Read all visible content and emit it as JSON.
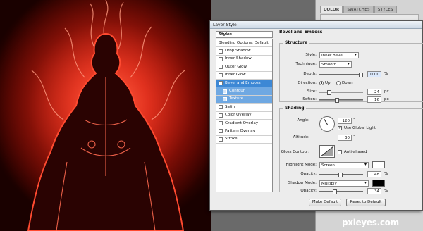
{
  "dialog": {
    "title": "Layer Style",
    "styles_header": "Styles",
    "style_items": [
      {
        "label": "Blending Options: Default",
        "checkbox": false,
        "state": "normal"
      },
      {
        "label": "Drop Shadow",
        "checkbox": true,
        "checked": false,
        "state": "normal"
      },
      {
        "label": "Inner Shadow",
        "checkbox": true,
        "checked": false,
        "state": "normal"
      },
      {
        "label": "Outer Glow",
        "checkbox": true,
        "checked": false,
        "state": "normal"
      },
      {
        "label": "Inner Glow",
        "checkbox": true,
        "checked": false,
        "state": "normal"
      },
      {
        "label": "Bevel and Emboss",
        "checkbox": true,
        "checked": true,
        "state": "selected"
      },
      {
        "label": "Contour",
        "checkbox": true,
        "checked": false,
        "state": "sub"
      },
      {
        "label": "Texture",
        "checkbox": true,
        "checked": false,
        "state": "sub"
      },
      {
        "label": "Satin",
        "checkbox": true,
        "checked": false,
        "state": "normal"
      },
      {
        "label": "Color Overlay",
        "checkbox": true,
        "checked": false,
        "state": "normal"
      },
      {
        "label": "Gradient Overlay",
        "checkbox": true,
        "checked": false,
        "state": "normal"
      },
      {
        "label": "Pattern Overlay",
        "checkbox": true,
        "checked": false,
        "state": "normal"
      },
      {
        "label": "Stroke",
        "checkbox": true,
        "checked": false,
        "state": "normal"
      }
    ],
    "bevel": {
      "title": "Bevel and Emboss",
      "structure_title": "Structure",
      "style_label": "Style:",
      "style_value": "Inner Bevel",
      "technique_label": "Technique:",
      "technique_value": "Smooth",
      "depth_label": "Depth:",
      "depth_value": "1000",
      "depth_unit": "%",
      "depth_level": 1.0,
      "direction_label": "Direction:",
      "direction_up": "Up",
      "direction_down": "Down",
      "size_label": "Size:",
      "size_value": "24",
      "size_unit": "px",
      "size_level": 0.2,
      "soften_label": "Soften:",
      "soften_value": "16",
      "soften_unit": "px",
      "soften_level": 0.4
    },
    "shading": {
      "title": "Shading",
      "angle_label": "Angle:",
      "angle_value": "120",
      "angle_unit": "°",
      "global_light_label": "Use Global Light",
      "altitude_label": "Altitude:",
      "altitude_value": "30",
      "altitude_unit": "°",
      "gloss_label": "Gloss Contour:",
      "anti_aliased_label": "Anti-aliased",
      "highlight_mode_label": "Highlight Mode:",
      "highlight_mode_value": "Screen",
      "highlight_color": "#ffffff",
      "hl_opacity_label": "Opacity:",
      "hl_opacity_value": "48",
      "hl_opacity_unit": "%",
      "hl_opacity_level": 0.48,
      "shadow_mode_label": "Shadow Mode:",
      "shadow_mode_value": "Multiply",
      "shadow_color": "#000000",
      "sh_opacity_label": "Opacity:",
      "sh_opacity_value": "34",
      "sh_opacity_unit": "%",
      "sh_opacity_level": 0.34
    },
    "make_default": "Make Default",
    "reset_default": "Reset to Default"
  },
  "panel": {
    "tabs": [
      "COLOR",
      "SWATCHES",
      "STYLES"
    ]
  },
  "watermark": "pxleyes.com",
  "colors": {
    "selection": "#3d88d5",
    "sub_selection": "#6fa8e2",
    "fire": "#ff3b2a"
  }
}
